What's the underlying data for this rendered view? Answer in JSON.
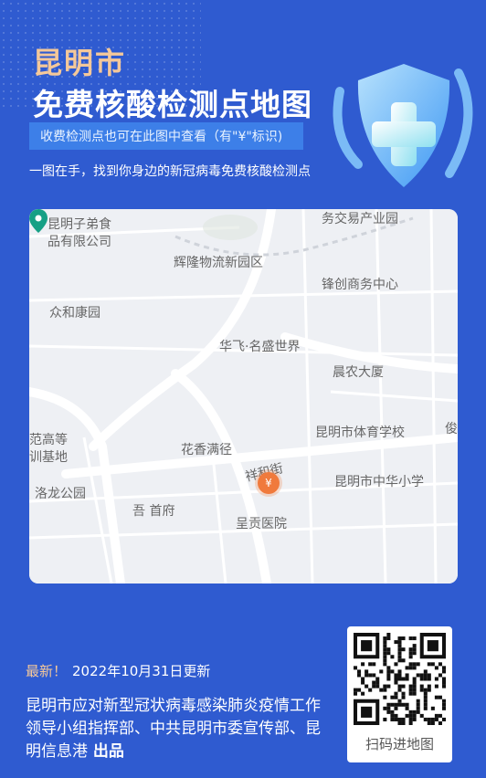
{
  "header": {
    "city": "昆明市",
    "title": "免费核酸检测点地图",
    "notice": "收费检测点也可在此图中查看（有\"¥\"标识)",
    "tagline": "一图在手，找到你身边的新冠病毒免费核酸检测点"
  },
  "map": {
    "labels": [
      {
        "id": "l1",
        "text": "昆明子弟食\n品有限公司"
      },
      {
        "id": "l2",
        "text": "务交易产业园"
      },
      {
        "id": "l3",
        "text": "辉隆物流新园区"
      },
      {
        "id": "l4",
        "text": "锋创商务中心"
      },
      {
        "id": "l5",
        "text": "众和康园"
      },
      {
        "id": "l6",
        "text": "华飞·名盛世界"
      },
      {
        "id": "l7",
        "text": "晨农大厦"
      },
      {
        "id": "l8",
        "text": "昆明市体育学校"
      },
      {
        "id": "l9",
        "text": "俊"
      },
      {
        "id": "l10",
        "text": "范高等\n训基地"
      },
      {
        "id": "l11",
        "text": "花香满径"
      },
      {
        "id": "l12",
        "text": "祥和街"
      },
      {
        "id": "l13",
        "text": "昆明市中华小学"
      },
      {
        "id": "l14",
        "text": "洛龙公园"
      },
      {
        "id": "l15",
        "text": "吾   首府"
      },
      {
        "id": "l16",
        "text": "呈贡医院"
      }
    ],
    "price_pin": "¥"
  },
  "footer": {
    "new_label": "最新！",
    "update_text": "2022年10月31日更新",
    "publisher": "昆明市应对新型冠状病毒感染肺炎疫情工作领导小组指挥部、中共昆明市委宣传部、昆明信息港",
    "publisher_suffix": " 出品",
    "qr_label": "扫码进地图"
  },
  "colors": {
    "background": "#2f5bd0",
    "accent": "#f4c89a",
    "notice_bg": "#3d7fe8",
    "price_pin": "#f07a3c",
    "location_pin": "#16a085"
  }
}
